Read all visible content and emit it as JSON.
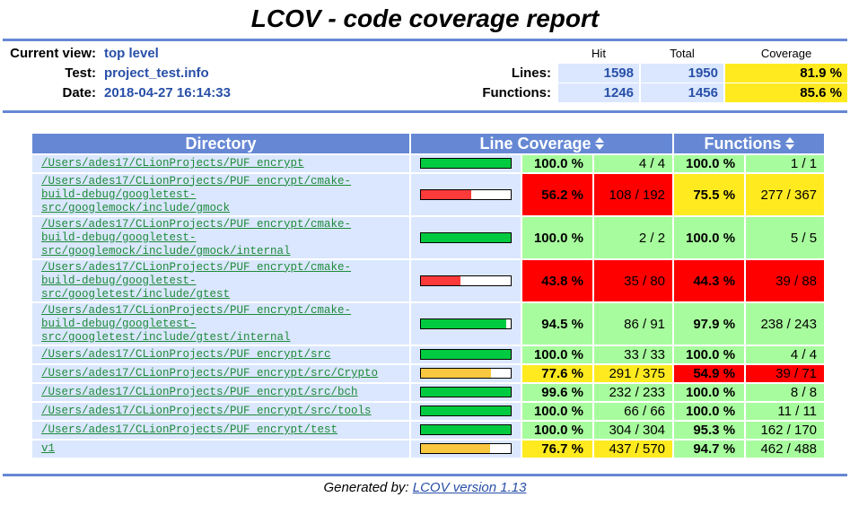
{
  "title": "LCOV - code coverage report",
  "header": {
    "current_view_label": "Current view:",
    "current_view_value": "top level",
    "test_label": "Test:",
    "test_value": "project_test.info",
    "date_label": "Date:",
    "date_value": "2018-04-27 16:14:33"
  },
  "summary": {
    "col_hit": "Hit",
    "col_total": "Total",
    "col_coverage": "Coverage",
    "lines_label": "Lines:",
    "lines_hit": "1598",
    "lines_total": "1950",
    "lines_coverage": "81.9 %",
    "functions_label": "Functions:",
    "functions_hit": "1246",
    "functions_total": "1456",
    "functions_coverage": "85.6 %"
  },
  "table": {
    "col_directory": "Directory",
    "col_line_coverage": "Line Coverage",
    "col_functions": "Functions",
    "rows": [
      {
        "dir": [
          "/Users/ades17/CLionProjects/PUF_encrypt"
        ],
        "bar": 1.0,
        "bar_level": "hi",
        "line_pct": "100.0 %",
        "line_level": "hi",
        "line_frac": "4 / 4",
        "fn_pct": "100.0 %",
        "fn_level": "hi",
        "fn_frac": "1 / 1"
      },
      {
        "dir": [
          "/Users/ades17/CLionProjects/PUF_encrypt/cmake-",
          "build-debug/googletest-",
          "src/googlemock/include/gmock"
        ],
        "bar": 0.562,
        "bar_level": "lo",
        "line_pct": "56.2 %",
        "line_level": "lo",
        "line_frac": "108 / 192",
        "fn_pct": "75.5 %",
        "fn_level": "med",
        "fn_frac": "277 / 367"
      },
      {
        "dir": [
          "/Users/ades17/CLionProjects/PUF_encrypt/cmake-",
          "build-debug/googletest-",
          "src/googlemock/include/gmock/internal"
        ],
        "bar": 1.0,
        "bar_level": "hi",
        "line_pct": "100.0 %",
        "line_level": "hi",
        "line_frac": "2 / 2",
        "fn_pct": "100.0 %",
        "fn_level": "hi",
        "fn_frac": "5 / 5"
      },
      {
        "dir": [
          "/Users/ades17/CLionProjects/PUF_encrypt/cmake-",
          "build-debug/googletest-",
          "src/googletest/include/gtest"
        ],
        "bar": 0.438,
        "bar_level": "lo",
        "line_pct": "43.8 %",
        "line_level": "lo",
        "line_frac": "35 / 80",
        "fn_pct": "44.3 %",
        "fn_level": "lo",
        "fn_frac": "39 / 88"
      },
      {
        "dir": [
          "/Users/ades17/CLionProjects/PUF_encrypt/cmake-",
          "build-debug/googletest-",
          "src/googletest/include/gtest/internal"
        ],
        "bar": 0.945,
        "bar_level": "hi",
        "line_pct": "94.5 %",
        "line_level": "hi",
        "line_frac": "86 / 91",
        "fn_pct": "97.9 %",
        "fn_level": "hi",
        "fn_frac": "238 / 243"
      },
      {
        "dir": [
          "/Users/ades17/CLionProjects/PUF_encrypt/src"
        ],
        "bar": 1.0,
        "bar_level": "hi",
        "line_pct": "100.0 %",
        "line_level": "hi",
        "line_frac": "33 / 33",
        "fn_pct": "100.0 %",
        "fn_level": "hi",
        "fn_frac": "4 / 4"
      },
      {
        "dir": [
          "/Users/ades17/CLionProjects/PUF_encrypt/src/Crypto"
        ],
        "bar": 0.776,
        "bar_level": "med",
        "line_pct": "77.6 %",
        "line_level": "med",
        "line_frac": "291 / 375",
        "fn_pct": "54.9 %",
        "fn_level": "lo",
        "fn_frac": "39 / 71"
      },
      {
        "dir": [
          "/Users/ades17/CLionProjects/PUF_encrypt/src/bch"
        ],
        "bar": 0.996,
        "bar_level": "hi",
        "line_pct": "99.6 %",
        "line_level": "hi",
        "line_frac": "232 / 233",
        "fn_pct": "100.0 %",
        "fn_level": "hi",
        "fn_frac": "8 / 8"
      },
      {
        "dir": [
          "/Users/ades17/CLionProjects/PUF_encrypt/src/tools"
        ],
        "bar": 1.0,
        "bar_level": "hi",
        "line_pct": "100.0 %",
        "line_level": "hi",
        "line_frac": "66 / 66",
        "fn_pct": "100.0 %",
        "fn_level": "hi",
        "fn_frac": "11 / 11"
      },
      {
        "dir": [
          "/Users/ades17/CLionProjects/PUF_encrypt/test"
        ],
        "bar": 1.0,
        "bar_level": "hi",
        "line_pct": "100.0 %",
        "line_level": "hi",
        "line_frac": "304 / 304",
        "fn_pct": "95.3 %",
        "fn_level": "hi",
        "fn_frac": "162 / 170"
      },
      {
        "dir": [
          "v1"
        ],
        "bar": 0.767,
        "bar_level": "med",
        "line_pct": "76.7 %",
        "line_level": "med",
        "line_frac": "437 / 570",
        "fn_pct": "94.7 %",
        "fn_level": "hi",
        "fn_frac": "462 / 488"
      }
    ]
  },
  "bar_colors": {
    "hi": "#00cb40",
    "med": "#f9c840",
    "lo": "#ff3a3a"
  },
  "footer": {
    "prefix": "Generated by:",
    "link": "LCOV version 1.13"
  }
}
